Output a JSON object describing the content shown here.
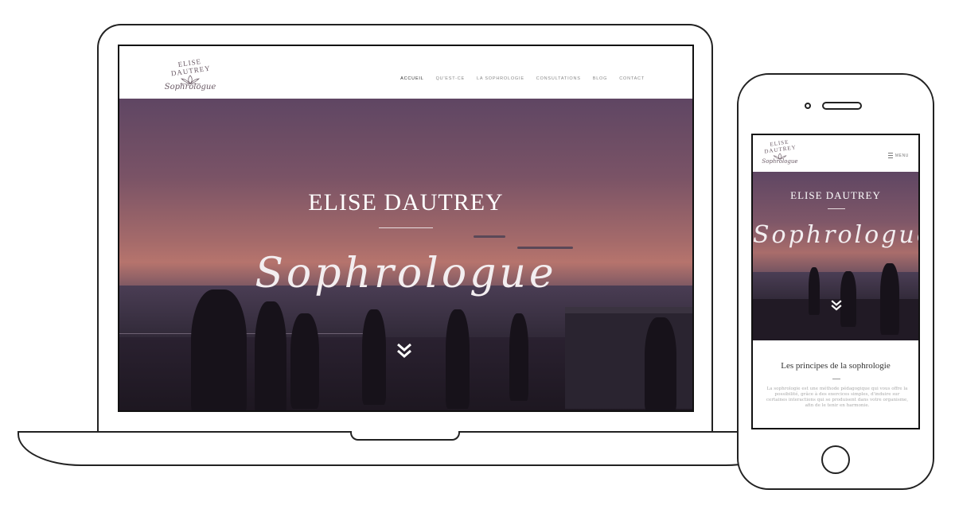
{
  "brand": {
    "name": "ELISE DAUTREY",
    "script": "Sophrologue"
  },
  "desktop": {
    "nav": [
      "ACCUEIL",
      "QU'EST-CE",
      "LA SOPHROLOGIE",
      "CONSULTATIONS",
      "BLOG",
      "CONTACT"
    ],
    "active_nav": "ACCUEIL",
    "hero_title": "ELISE DAUTREY",
    "hero_script": "Sophrologue",
    "scroll_icon": "double-chevron-down-icon"
  },
  "mobile": {
    "menu_label": "MENU",
    "menu_icon": "hamburger-icon",
    "hero_title": "ELISE DAUTREY",
    "hero_script": "Sophrologue",
    "scroll_icon": "double-chevron-down-icon",
    "section_title": "Les principes de la sophrologie",
    "section_text": "La sophrologie est une méthode pédagogique qui vous offre la possibilité, grâce à des exercices simples, d'induire sur certaines interactions qui se produisent dans votre organisme, afin de le tenir en harmonie."
  },
  "colors": {
    "hero_top": "#5f4663",
    "hero_sunset": "#b6746d",
    "hero_bottom": "#2b2232",
    "logo": "#6b5b66"
  }
}
